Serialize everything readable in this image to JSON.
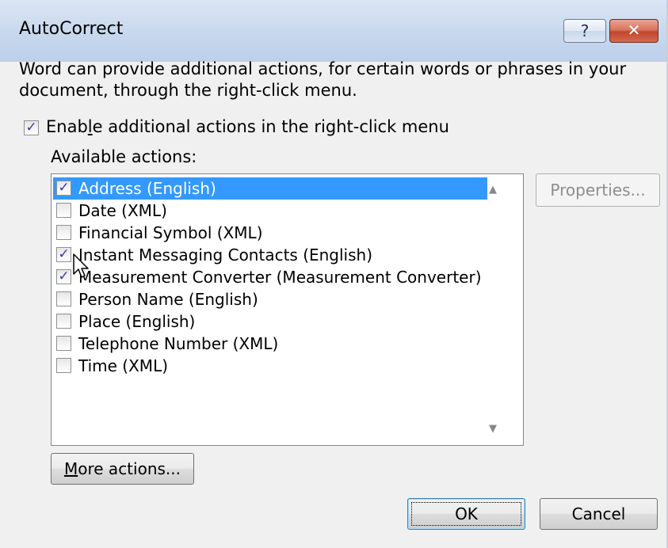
{
  "window": {
    "title": "AutoCorrect",
    "help_glyph": "?",
    "close_glyph": "✕"
  },
  "description": "Word can provide additional actions, for certain words or phrases in your document, through the right-click menu.",
  "enable_checkbox": {
    "label_before": "Enab",
    "label_accel": "l",
    "label_after": "e additional actions in the right-click menu",
    "checked": true
  },
  "available_actions_label": "Available actions:",
  "actions": [
    {
      "label": "Address (English)",
      "checked": true,
      "selected": true
    },
    {
      "label": "Date (XML)",
      "checked": false,
      "selected": false
    },
    {
      "label": "Financial Symbol (XML)",
      "checked": false,
      "selected": false
    },
    {
      "label": "Instant Messaging Contacts (English)",
      "checked": true,
      "selected": false
    },
    {
      "label": "Measurement Converter (Measurement Converter)",
      "checked": true,
      "selected": false
    },
    {
      "label": "Person Name (English)",
      "checked": false,
      "selected": false
    },
    {
      "label": "Place (English)",
      "checked": false,
      "selected": false
    },
    {
      "label": "Telephone Number (XML)",
      "checked": false,
      "selected": false
    },
    {
      "label": "Time (XML)",
      "checked": false,
      "selected": false
    }
  ],
  "check_glyph": "✓",
  "buttons": {
    "properties": "Properties...",
    "more_actions_accel": "M",
    "more_actions_rest": "ore actions...",
    "ok": "OK",
    "cancel": "Cancel"
  },
  "colors": {
    "selection": "#3399ff",
    "titlebar": "#c9d9ee",
    "close_button": "#c1462d"
  }
}
